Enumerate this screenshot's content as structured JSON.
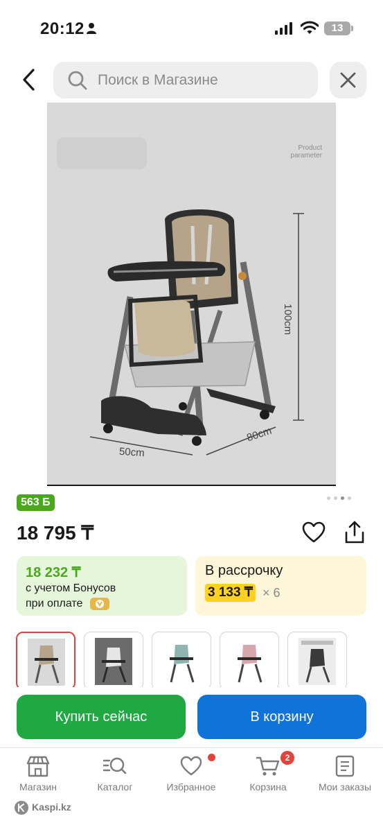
{
  "status_bar": {
    "time": "20:12",
    "battery": "13"
  },
  "search": {
    "placeholder": "Поиск в Магазине"
  },
  "product_image": {
    "caption_line1": "Product",
    "caption_line2": "parameter",
    "dim_height": "100cm",
    "dim_width": "50cm",
    "dim_depth": "80cm"
  },
  "bonus_badge": "563 Б",
  "carousel": {
    "total": 4,
    "active": 2
  },
  "price": "18 795 ₸",
  "bonus_card": {
    "price": "18 232 ₸",
    "line1": "с учетом Бонусов",
    "line2": "при оплате"
  },
  "installment_card": {
    "title": "В рассрочку",
    "monthly": "3 133 ₸",
    "multiplier": "× 6"
  },
  "thumbnails": [
    {
      "selected": true
    },
    {
      "selected": false
    },
    {
      "selected": false
    },
    {
      "selected": false
    },
    {
      "selected": false
    }
  ],
  "actions": {
    "buy_now": "Купить сейчас",
    "to_cart": "В корзину"
  },
  "nav": {
    "shop": "Магазин",
    "catalog": "Каталог",
    "favorites": "Избранное",
    "cart": "Корзина",
    "cart_count": "2",
    "orders": "Мои заказы"
  },
  "brand": "Kaspi.kz",
  "colors": {
    "accent_green": "#20a843",
    "accent_blue": "#1073d9",
    "badge_green": "#4aa81c",
    "alert_red": "#e3433a",
    "installment_yellow": "#ffd21f"
  }
}
